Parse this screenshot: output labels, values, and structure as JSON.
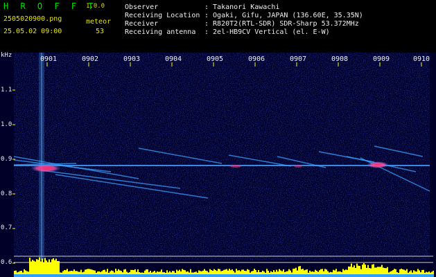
{
  "header": {
    "app_name": "H R O F F T",
    "version": "1.0.0",
    "filename": "2505020900.png",
    "type_label": "meteor",
    "datetime": "25.05.02 09:00",
    "count": "53",
    "info": [
      {
        "label": "Observer",
        "value": ": Takanori Kawachi"
      },
      {
        "label": "Receiving Location",
        "value": ": Ogaki, Gifu, JAPAN (136.60E, 35.35N)"
      },
      {
        "label": "Receiver",
        "value": ": R820T2(RTL-SDR) SDR-Sharp 53.372MHz"
      },
      {
        "label": "Receiving antenna",
        "value": ": 2el-HB9CV Vertical (el. E-W)"
      }
    ]
  },
  "spectrogram": {
    "unit": "kHz",
    "y_ticks": [
      "1.1",
      "1.0",
      "0.9",
      "0.8",
      "0.7",
      "0.6"
    ],
    "x_ticks": [
      "0901",
      "0902",
      "0903",
      "0904",
      "0905",
      "0906",
      "0907",
      "0908",
      "0909",
      "0910"
    ],
    "colors": {
      "background": "#000030",
      "trace": "#40a0ff",
      "hot": "#ff3070",
      "level": "#ffff00"
    }
  }
}
